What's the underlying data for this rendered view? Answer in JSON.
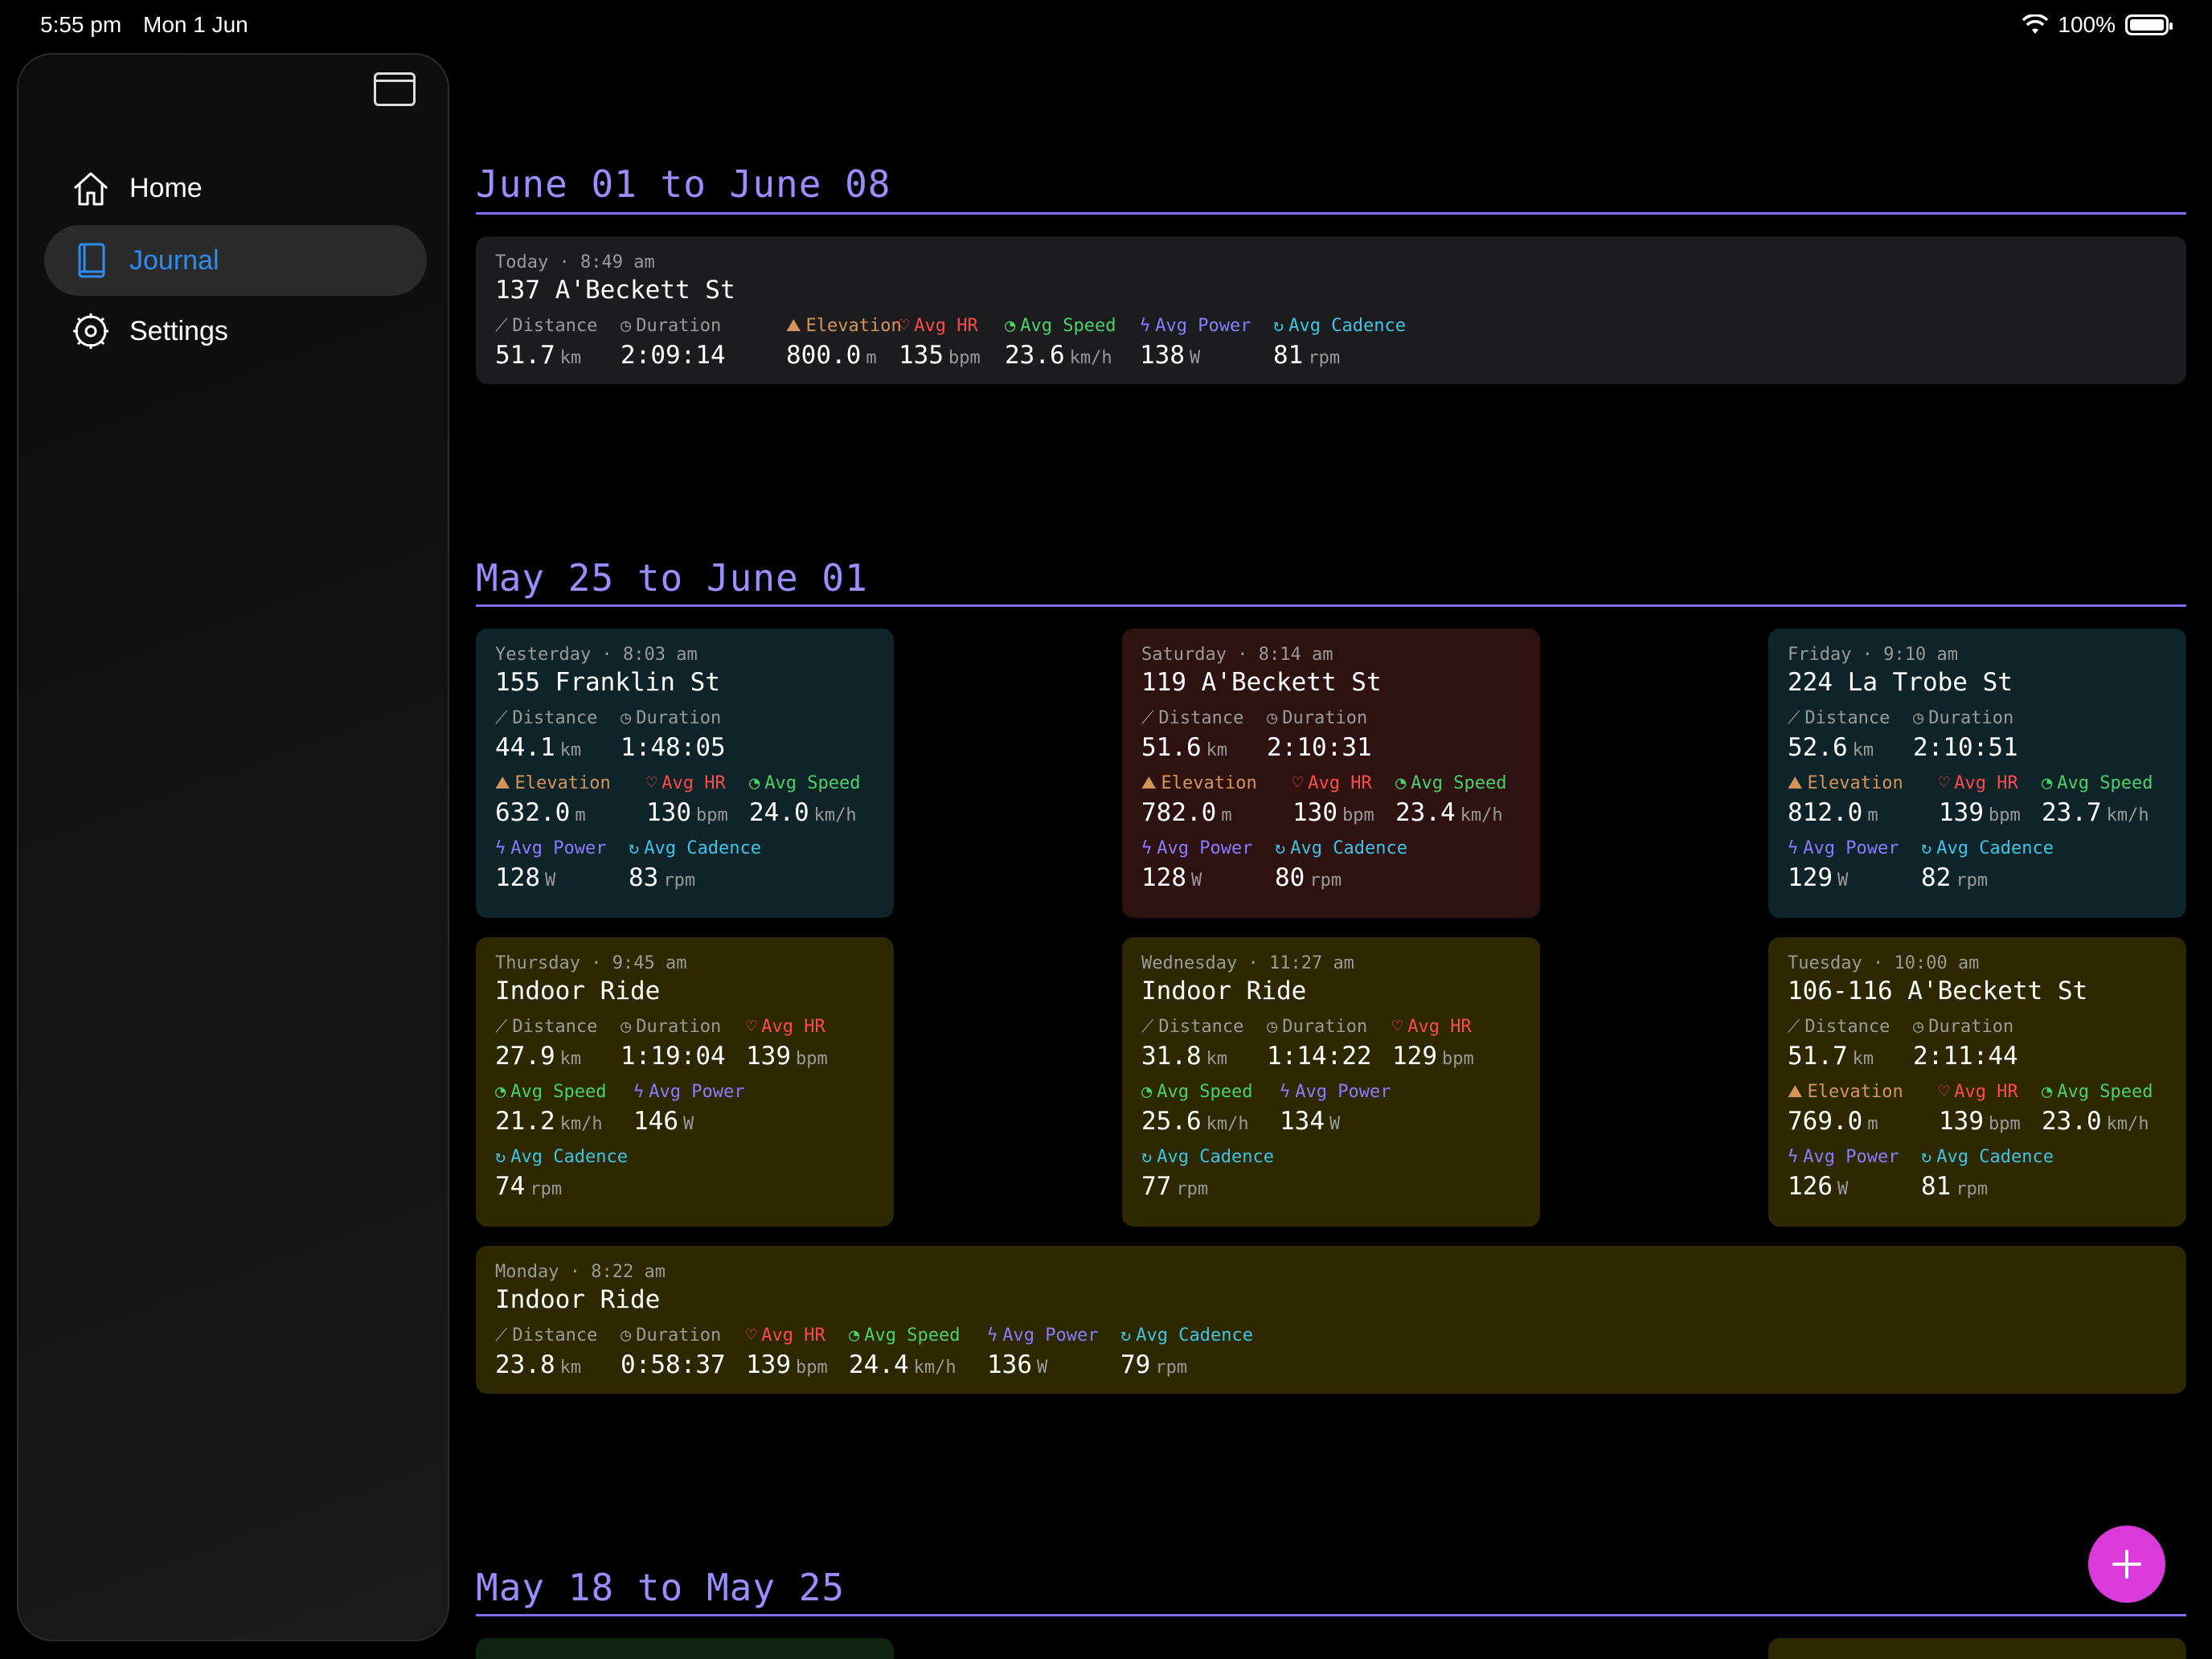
{
  "status_bar": {
    "time": "5:55 pm",
    "date": "Mon 1 Jun",
    "battery": "100%"
  },
  "sidebar": {
    "items": [
      {
        "label": "Home",
        "icon": "home-icon"
      },
      {
        "label": "Journal",
        "icon": "book-icon",
        "active": true
      },
      {
        "label": "Settings",
        "icon": "gear-icon"
      }
    ]
  },
  "labels": {
    "distance": "Distance",
    "duration": "Duration",
    "elevation": "Elevation",
    "avg_hr": "Avg HR",
    "avg_speed": "Avg Speed",
    "avg_power": "Avg Power",
    "avg_cadence": "Avg Cadence"
  },
  "units": {
    "km": "km",
    "m": "m",
    "bpm": "bpm",
    "kmh": "km/h",
    "w": "W",
    "rpm": "rpm"
  },
  "weeks": [
    {
      "title": "June 01 to June 08",
      "rides": [
        {
          "day": "Today",
          "time": "8:49 am",
          "title": "137 A'Beckett St",
          "distance": "51.7",
          "duration": "2:09:14",
          "elevation": "800.0",
          "hr": "135",
          "speed": "23.6",
          "power": "138",
          "cadence": "81"
        }
      ]
    },
    {
      "title": "May 25 to June 01",
      "rides": [
        {
          "day": "Yesterday",
          "time": "8:03 am",
          "title": "155 Franklin St",
          "distance": "44.1",
          "duration": "1:48:05",
          "elevation": "632.0",
          "hr": "130",
          "speed": "24.0",
          "power": "128",
          "cadence": "83"
        },
        {
          "day": "Saturday",
          "time": "8:14 am",
          "title": "119 A'Beckett St",
          "distance": "51.6",
          "duration": "2:10:31",
          "elevation": "782.0",
          "hr": "130",
          "speed": "23.4",
          "power": "128",
          "cadence": "80"
        },
        {
          "day": "Friday",
          "time": "9:10 am",
          "title": "224 La Trobe St",
          "distance": "52.6",
          "duration": "2:10:51",
          "elevation": "812.0",
          "hr": "139",
          "speed": "23.7",
          "power": "129",
          "cadence": "82"
        },
        {
          "day": "Thursday",
          "time": "9:45 am",
          "title": "Indoor Ride",
          "distance": "27.9",
          "duration": "1:19:04",
          "hr": "139",
          "speed": "21.2",
          "power": "146",
          "cadence": "74"
        },
        {
          "day": "Wednesday",
          "time": "11:27 am",
          "title": "Indoor Ride",
          "distance": "31.8",
          "duration": "1:14:22",
          "hr": "129",
          "speed": "25.6",
          "power": "134",
          "cadence": "77"
        },
        {
          "day": "Tuesday",
          "time": "10:00 am",
          "title": "106-116 A'Beckett St",
          "distance": "51.7",
          "duration": "2:11:44",
          "elevation": "769.0",
          "hr": "139",
          "speed": "23.0",
          "power": "126",
          "cadence": "81"
        },
        {
          "day": "Monday",
          "time": "8:22 am",
          "title": "Indoor Ride",
          "distance": "23.8",
          "duration": "0:58:37",
          "hr": "139",
          "speed": "24.4",
          "power": "136",
          "cadence": "79"
        }
      ]
    },
    {
      "title": "May 18 to May 25",
      "rides": []
    }
  ],
  "colors": {
    "accent": "#9b8cff",
    "journal_active": "#2c8cf0",
    "fab": "#d93ad9",
    "card_gray": "#1c1c1e",
    "card_teal": "#0e2428",
    "card_red": "#2e1212",
    "card_olive": "#2e2800"
  }
}
